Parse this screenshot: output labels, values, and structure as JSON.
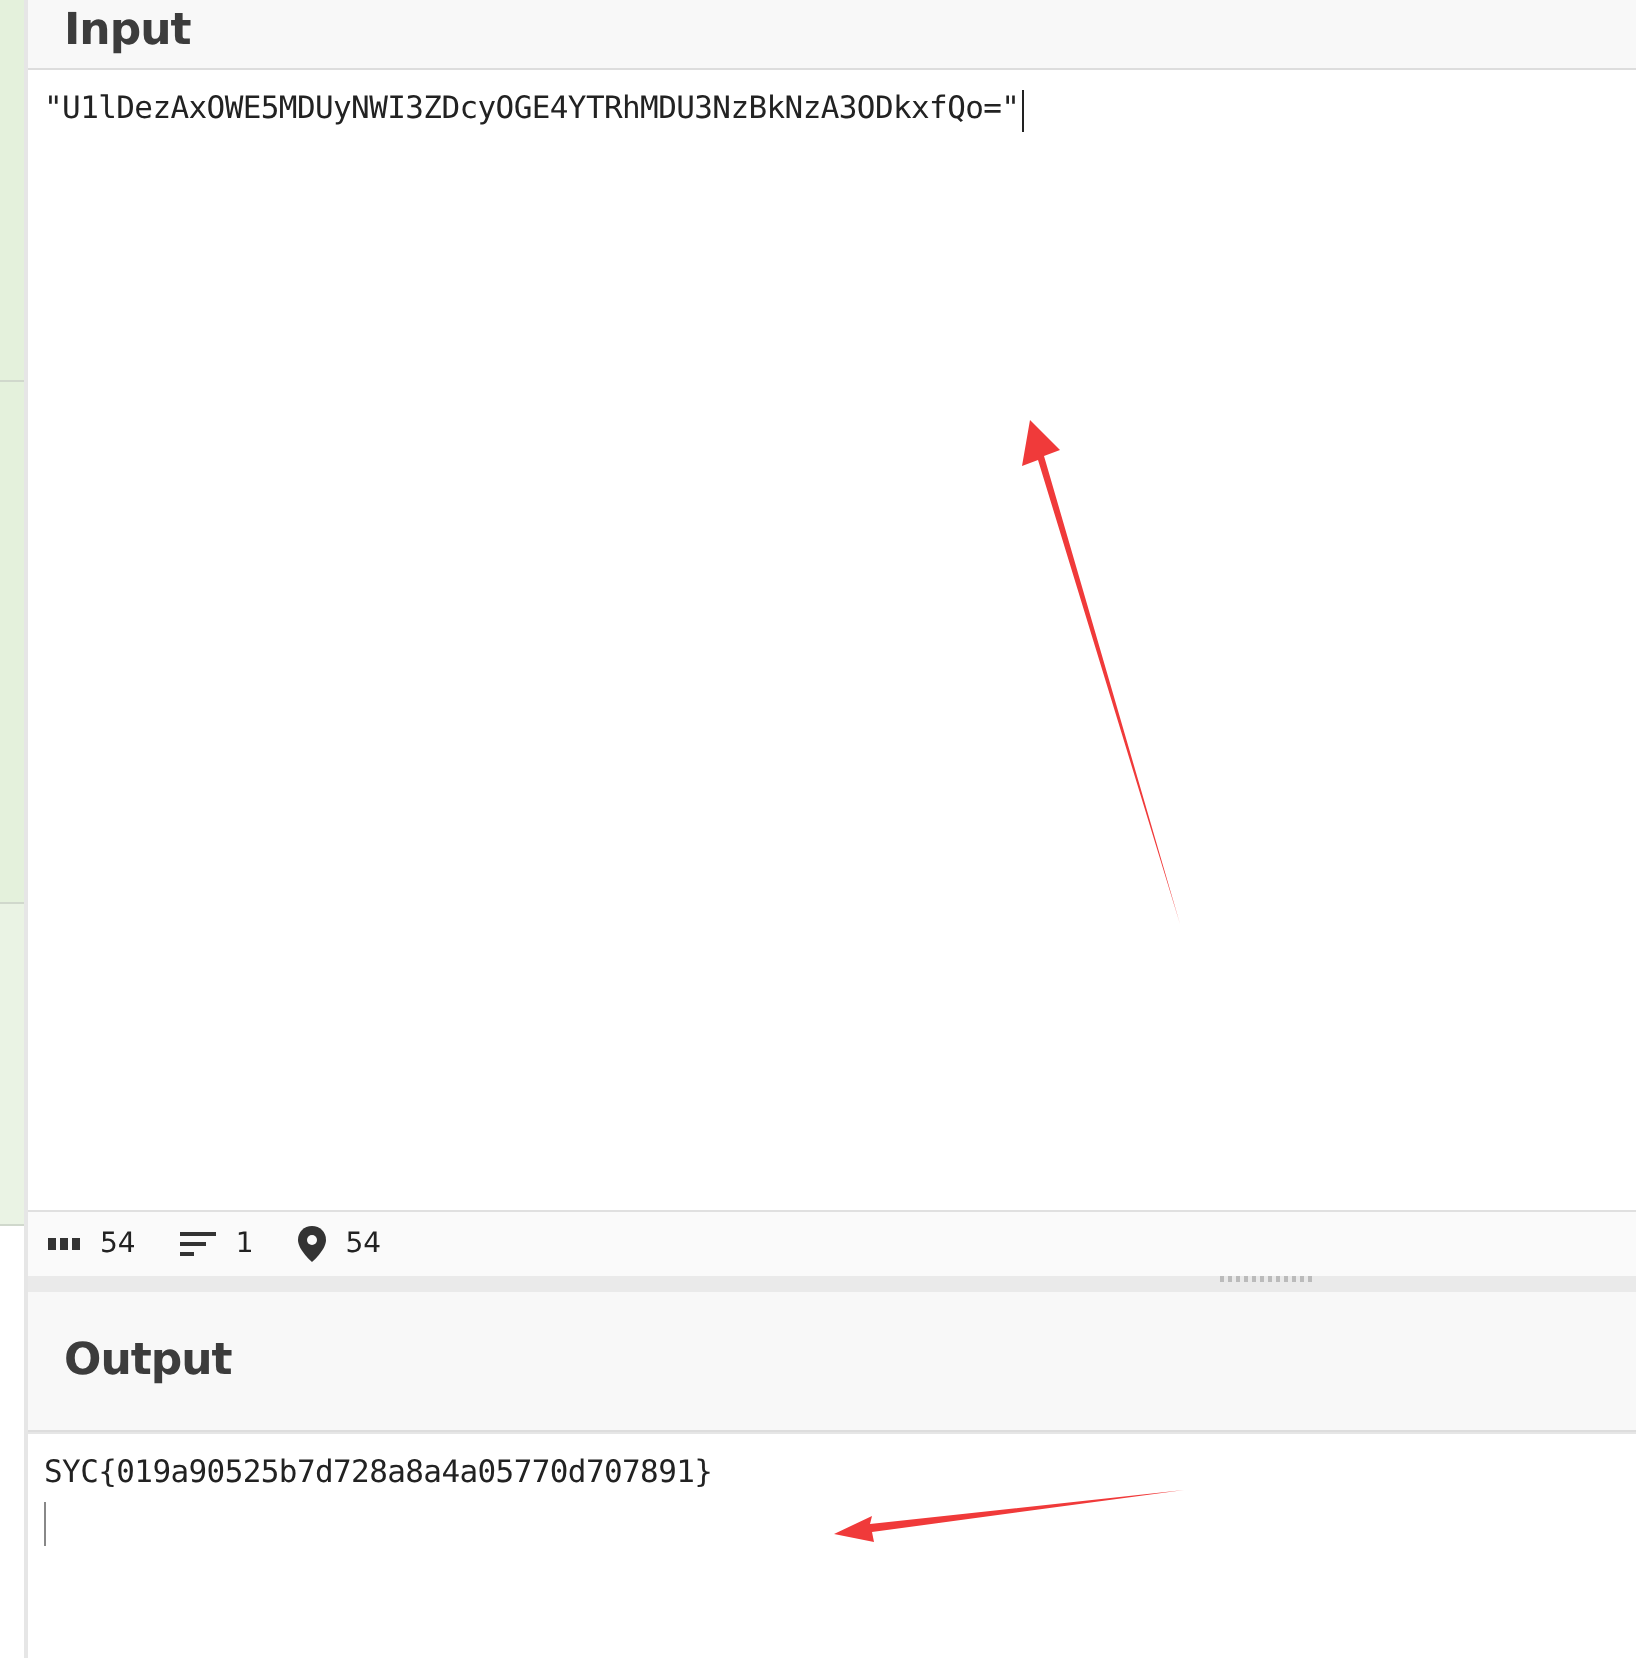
{
  "input": {
    "title": "Input",
    "value": "\"U1lDezAxOWE5MDUyNWI3ZDcyOGE4YTRhMDU3NzBkNzA3ODkxfQo=\""
  },
  "status_bar": [
    {
      "kind": "length",
      "value": "54"
    },
    {
      "kind": "lines",
      "value": "1"
    },
    {
      "kind": "position",
      "value": "54"
    }
  ],
  "output": {
    "title": "Output",
    "value": "SYC{019a90525b7d728a8a4a05770d707891}"
  }
}
